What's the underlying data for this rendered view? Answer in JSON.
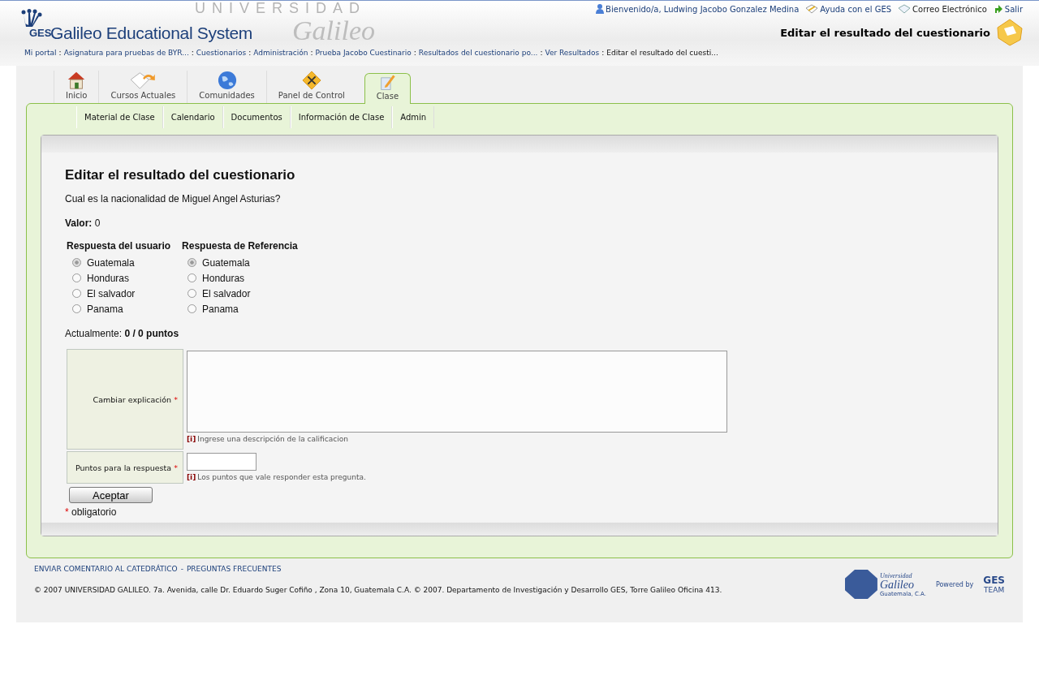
{
  "header": {
    "banner_text": [
      "UNIVERSIDAD",
      "Galileo"
    ],
    "logo_mark": "GES",
    "logo_text": "Galileo Educational System",
    "user_links": [
      {
        "kind": "user",
        "label": "Bienvenido/a, Ludwing Jacobo Gonzalez Medina"
      },
      {
        "kind": "help",
        "label": "Ayuda con el GES"
      },
      {
        "kind": "mail",
        "label": "Correo Electrónico"
      },
      {
        "kind": "exit",
        "label": "Salir"
      }
    ],
    "page_title": "Editar el resultado del cuestionario",
    "breadcrumb_separator": ":",
    "breadcrumbs": [
      {
        "label": "Mi portal",
        "current": false
      },
      {
        "label": "Asignatura para pruebas de BYR...",
        "current": false
      },
      {
        "label": "Cuestionarios",
        "current": false
      },
      {
        "label": "Administración",
        "current": false
      },
      {
        "label": "Prueba Jacobo Cuestinario",
        "current": false
      },
      {
        "label": "Resultados del cuestionario po...",
        "current": false
      },
      {
        "label": "Ver Resultados",
        "current": false
      },
      {
        "label": "Editar el resultado del cuesti...",
        "current": true
      }
    ]
  },
  "tabs": [
    {
      "kind": "home",
      "label": "Inicio",
      "selected": false
    },
    {
      "kind": "courses",
      "label": "Cursos Actuales",
      "selected": false
    },
    {
      "kind": "globe",
      "label": "Comunidades",
      "selected": false
    },
    {
      "kind": "tools",
      "label": "Panel de Control",
      "selected": false
    },
    {
      "kind": "pencil",
      "label": "Clase",
      "selected": true
    }
  ],
  "subtabs": [
    "Material de Clase",
    "Calendario",
    "Documentos",
    "Información de Clase",
    "Admin"
  ],
  "content": {
    "title": "Editar el resultado del cuestionario",
    "question": "Cual es la nacionalidad de Miguel Angel Asturias?",
    "value_line": "**Valor:** 0",
    "answer_groups": [
      {
        "heading": "Respuesta del usuario",
        "options": [
          {
            "label": "Guatemala",
            "selected": true
          },
          {
            "label": "Honduras",
            "selected": false
          },
          {
            "label": "El salvador",
            "selected": false
          },
          {
            "label": "Panama",
            "selected": false
          }
        ]
      },
      {
        "heading": "Respuesta de Referencia",
        "options": [
          {
            "label": "Guatemala",
            "selected": true
          },
          {
            "label": "Honduras",
            "selected": false
          },
          {
            "label": "El salvador",
            "selected": false
          },
          {
            "label": "Panama",
            "selected": false
          }
        ]
      }
    ],
    "current_line": "Actualmente: **0 / 0 puntos**",
    "form": [
      {
        "kind": "textarea",
        "label": "Cambiar explicación",
        "required_mark": "*",
        "info_mark": "[i]",
        "hint": "Ingrese una descripción de la calificacion"
      },
      {
        "kind": "input",
        "label": "Puntos para la respuesta",
        "required_mark": "*",
        "info_mark": "[i]",
        "hint": "Los puntos que vale responder esta pregunta."
      }
    ],
    "submit": "Aceptar",
    "required_note": {
      "mark": "*",
      "text": "obligatorio"
    }
  },
  "footer": {
    "links": [
      "ENVIAR COMENTARIO AL CATEDRÁTICO",
      "PREGUNTAS FRECUENTES"
    ],
    "separator": "-",
    "copyright": "© 2007 UNIVERSIDAD GALILEO. 7a. Avenida, calle Dr. Eduardo Suger Cofiño , Zona 10, Guatemala C.A. © 2007. Departamento de Investigación y Desarrollo GES, Torre Galileo Oficina 413.",
    "university_logo": {
      "line1": "Universidad",
      "line2": "Galileo",
      "line3": "Guatemala, C.A."
    },
    "powered_by": "Powered by",
    "team_logo": {
      "mark": "GES",
      "text": "TEAM"
    }
  }
}
